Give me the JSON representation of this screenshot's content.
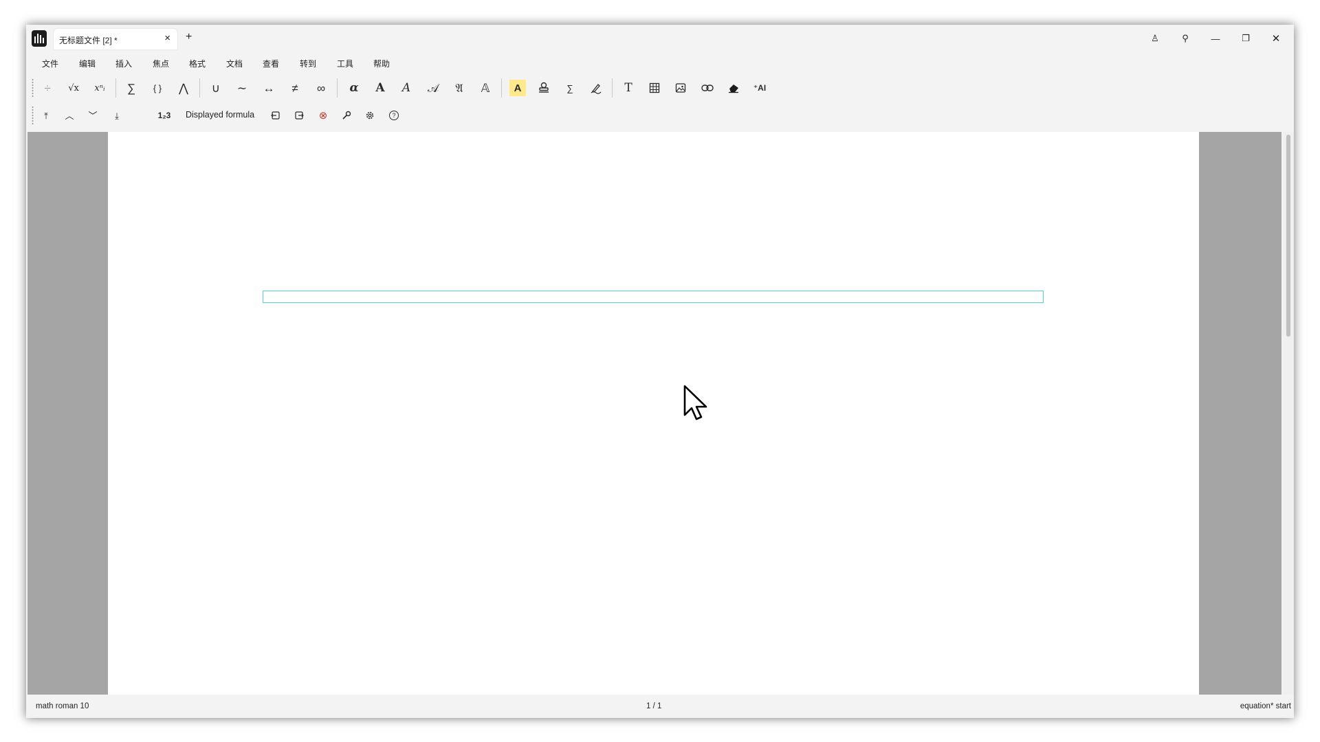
{
  "tab": {
    "title": "无标题文件 [2] *",
    "close": "×",
    "add": "+"
  },
  "window_controls": {
    "user": "♙",
    "pin": "⚲",
    "minimize": "—",
    "restore": "❐",
    "close": "✕"
  },
  "menu": [
    "文件",
    "编辑",
    "插入",
    "焦点",
    "格式",
    "文档",
    "查看",
    "转到",
    "工具",
    "帮助"
  ],
  "toolbar1": {
    "fraction": "÷",
    "sqrt": "√x",
    "script": "xⁿᵢ",
    "sum": "∑",
    "braces": "{ }",
    "wedge": "⋀",
    "union": "∪",
    "tilde": "∼",
    "arrow": "↔",
    "neq": "≠",
    "infinity": "∞",
    "alpha": "α",
    "bold_a": "A",
    "italic_a": "A",
    "script_a": "𝒜",
    "fraktur_a": "𝔄",
    "outline_a": "𝔸",
    "highlight_a": "A",
    "text_t": "T",
    "ai": "⁺AI"
  },
  "toolbar2": {
    "first": "⤒",
    "up": "︿",
    "down": "﹀",
    "last": "⤓",
    "numbering": "1₂3",
    "mode_label": "Displayed formula",
    "delete": "⊗",
    "help": "?"
  },
  "status": {
    "left": "math roman 10",
    "center": "1 / 1",
    "right": "equation* start"
  },
  "colors": {
    "highlight": "#ffe98a",
    "formula_border": "#4fd2d8",
    "delete_red": "#c0392b",
    "gutter": "#a5a5a5"
  }
}
